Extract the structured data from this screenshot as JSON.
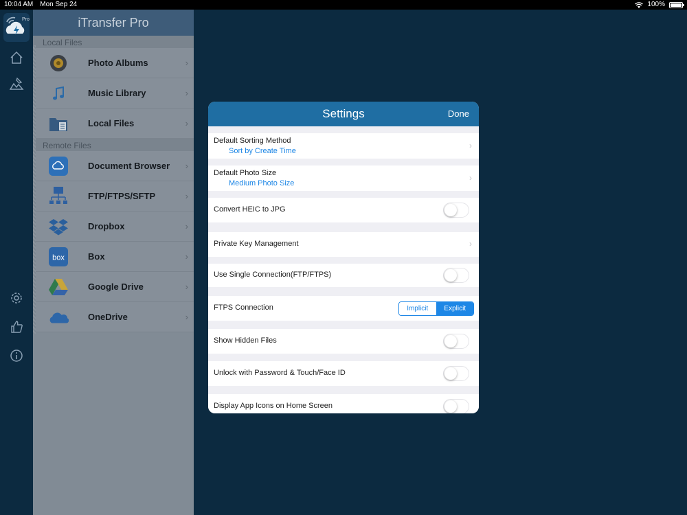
{
  "status_bar": {
    "time": "10:04 AM",
    "date": "Mon Sep 24",
    "battery": "100%"
  },
  "rail": {
    "logo_badge": "Pro",
    "icons": [
      "home-icon",
      "image-edit-icon",
      "gear-icon",
      "thumbs-up-icon",
      "info-icon"
    ]
  },
  "sidebar": {
    "title": "iTransfer Pro",
    "local_header": "Local Files",
    "remote_header": "Remote Files",
    "local_items": [
      {
        "label": "Photo Albums",
        "icon": "photo-albums-icon"
      },
      {
        "label": "Music Library",
        "icon": "music-note-icon"
      },
      {
        "label": "Local Files",
        "icon": "folder-icon"
      }
    ],
    "remote_items": [
      {
        "label": "Document Browser",
        "icon": "icloud-icon"
      },
      {
        "label": "FTP/FTPS/SFTP",
        "icon": "network-icon"
      },
      {
        "label": "Dropbox",
        "icon": "dropbox-icon"
      },
      {
        "label": "Box",
        "icon": "box-icon"
      },
      {
        "label": "Google Drive",
        "icon": "google-drive-icon"
      },
      {
        "label": "OneDrive",
        "icon": "onedrive-icon"
      }
    ]
  },
  "settings": {
    "title": "Settings",
    "done_label": "Done",
    "sorting_label": "Default Sorting Method",
    "sorting_value": "Sort by Create Time",
    "photo_size_label": "Default Photo Size",
    "photo_size_value": "Medium Photo Size",
    "heic_label": "Convert HEIC to JPG",
    "private_key_label": "Private Key Management",
    "single_conn_label": "Use Single Connection(FTP/FTPS)",
    "ftps_label": "FTPS Connection",
    "ftps_options": [
      "Implicit",
      "Explicit"
    ],
    "ftps_selected": "Explicit",
    "hidden_files_label": "Show Hidden Files",
    "unlock_label": "Unlock with Password & Touch/Face ID",
    "app_icons_label": "Display App Icons on Home Screen",
    "toggles": {
      "heic": false,
      "single_conn": false,
      "hidden_files": false,
      "unlock": false,
      "app_icons": false
    }
  },
  "colors": {
    "background": "#0c2a40",
    "header_blue": "#1f6ea3",
    "accent_blue": "#1e87e6"
  }
}
